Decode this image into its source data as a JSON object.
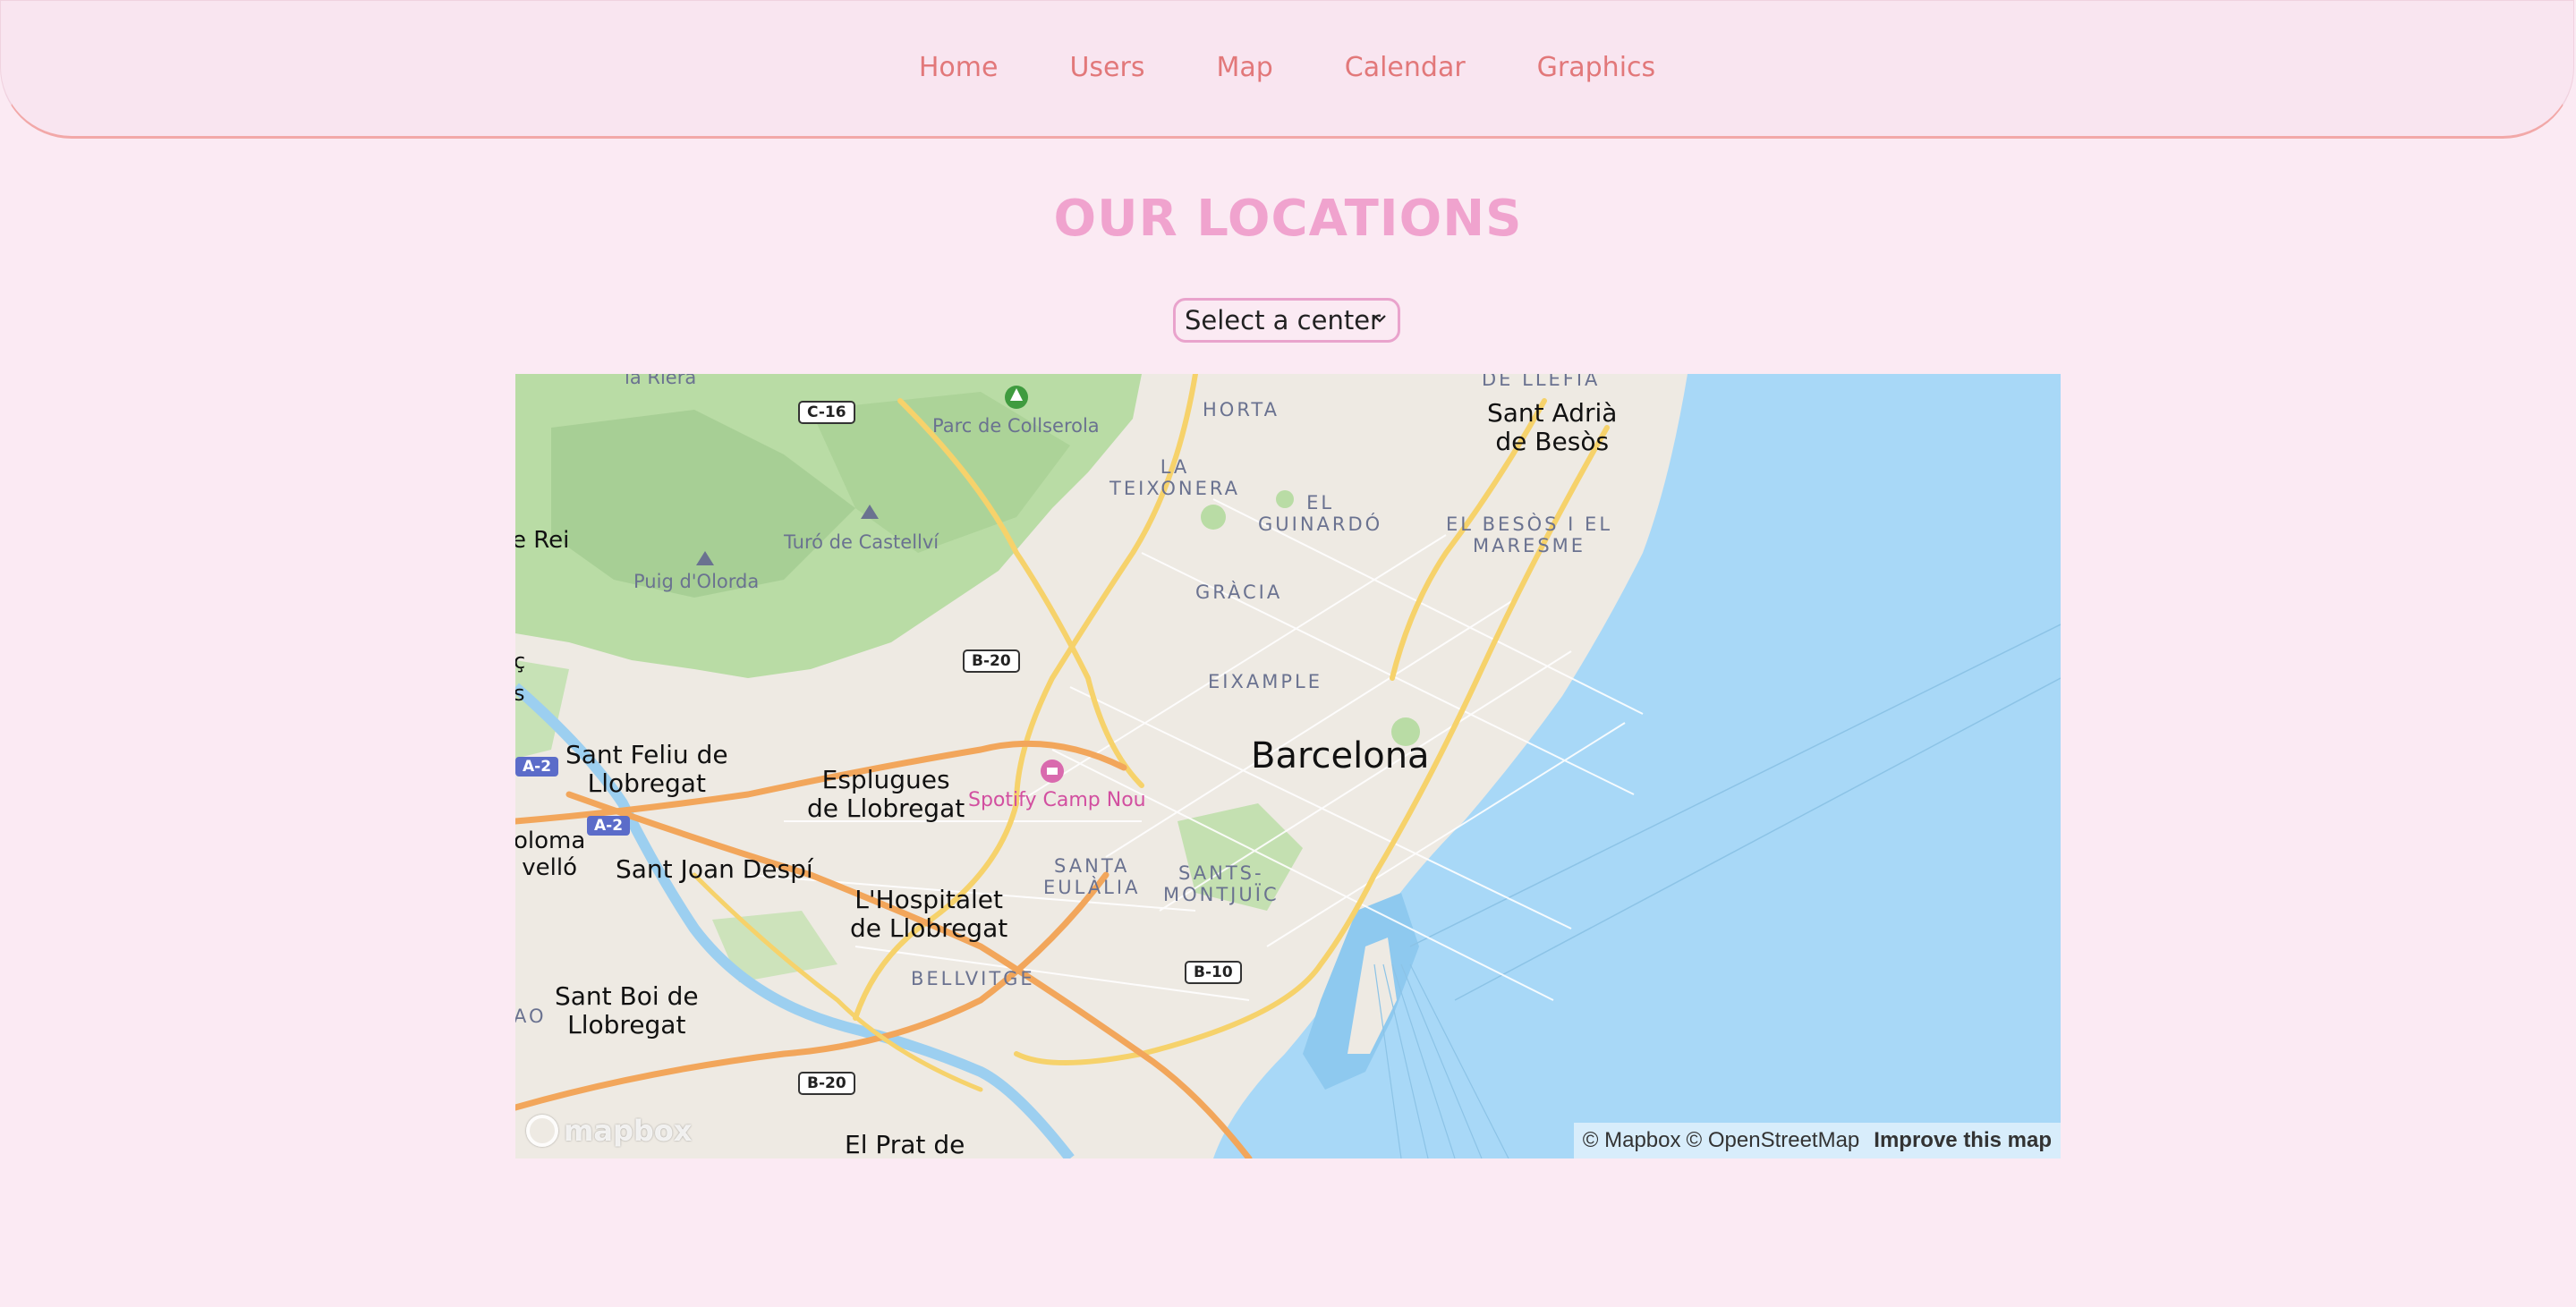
{
  "nav": {
    "items": [
      {
        "label": "Home"
      },
      {
        "label": "Users"
      },
      {
        "label": "Map"
      },
      {
        "label": "Calendar"
      },
      {
        "label": "Graphics"
      }
    ]
  },
  "page": {
    "title": "OUR LOCATIONS"
  },
  "center_select": {
    "selected": "Select a center"
  },
  "map": {
    "labels": {
      "la_riera": "la Riera",
      "parc_collserola": "Parc de Collserola",
      "horta": "HORTA",
      "sant_adria_1": "Sant Adrià",
      "sant_adria_2": "de Besòs",
      "de_llefia": "DE LLEFIA",
      "la_teixonera_1": "LA",
      "la_teixonera_2": "TEIXONERA",
      "el_guinardo_1": "EL",
      "el_guinardo_2": "GUINARDÓ",
      "el_besos_1": "EL BESÒS I EL",
      "el_besos_2": "MARESME",
      "e_rei": "e Rei",
      "turo_castellvi": "Turó de Castellví",
      "puig_olorda": "Puig d'Olorda",
      "gracia": "GRÀCIA",
      "eixample": "EIXAMPLE",
      "barcelona": "Barcelona",
      "sant_feliu_1": "Sant Feliu de",
      "sant_feliu_2": "Llobregat",
      "esplugues_1": "Esplugues",
      "esplugues_2": "de Llobregat",
      "spotify_camp_nou": "Spotify Camp Nou",
      "coloma_1": "oloma",
      "coloma_2": "velló",
      "sant_joan_despi": "Sant Joan Despí",
      "santa_eulalia_1": "SANTA",
      "santa_eulalia_2": "EULÀLIA",
      "sants_montjuic_1": "SANTS-",
      "sants_montjuic_2": "MONTJUÏC",
      "hospitalet_1": "L'Hospitalet",
      "hospitalet_2": "de Llobregat",
      "bellvitge": "BELLVITGE",
      "sant_boi_1": "Sant Boi de",
      "sant_boi_2": "Llobregat",
      "ao": "AO",
      "el_prat": "El Prat de",
      "edge_c": "ç",
      "edge_s": "s"
    },
    "road_shields": {
      "c16": "C-16",
      "b20_north": "B-20",
      "b20_south": "B-20",
      "b10": "B-10",
      "a2_left": "A-2",
      "a2_mid": "A-2"
    },
    "logo_text": "mapbox",
    "attribution": {
      "mapbox": "© Mapbox",
      "osm": "© OpenStreetMap",
      "improve": "Improve this map"
    },
    "colors": {
      "sea": "#a8d8f7",
      "land": "#eeeae3",
      "park": "#b8dca4",
      "road_major": "#f6d26b",
      "road_motorway": "#f2a65b"
    }
  }
}
